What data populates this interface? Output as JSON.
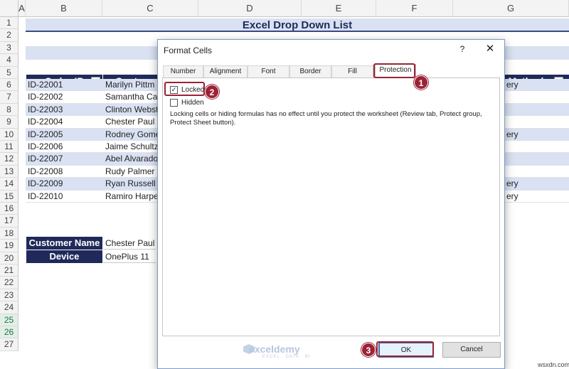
{
  "sheet": {
    "columns": [
      "A",
      "B",
      "C",
      "D",
      "E",
      "F",
      "G"
    ],
    "rows": [
      "1",
      "2",
      "3",
      "4",
      "5",
      "6",
      "7",
      "8",
      "9",
      "10",
      "11",
      "12",
      "13",
      "14",
      "15",
      "16",
      "17",
      "18",
      "19",
      "20",
      "21",
      "22",
      "23",
      "24",
      "25",
      "26",
      "27"
    ],
    "title": "Excel Drop Down List",
    "table_headers": {
      "order_id": "Order ID",
      "customer": "Customer",
      "method": "t Method"
    },
    "order_ids": [
      "ID-22001",
      "ID-22002",
      "ID-22003",
      "ID-22004",
      "ID-22005",
      "ID-22006",
      "ID-22007",
      "ID-22008",
      "ID-22009",
      "ID-22010"
    ],
    "customers": [
      "Marilyn Pittm",
      "Samantha Ca",
      "Clinton Webst",
      "Chester Paul",
      "Rodney Gome",
      "Jaime Schultz",
      "Abel Alvarado",
      "Rudy Palmer",
      "Ryan Russell",
      "Ramiro Harpe"
    ],
    "methods": [
      "ery",
      "",
      "",
      "",
      "ery",
      "",
      "",
      "",
      "ery",
      "ery"
    ],
    "lookup": {
      "customer_label": "Customer Name",
      "customer_value": "Chester Paul",
      "device_label": "Device",
      "device_value": "OnePlus 11"
    }
  },
  "dialog": {
    "title": "Format Cells",
    "help": "?",
    "close": "✕",
    "tabs": [
      "Number",
      "Alignment",
      "Font",
      "Border",
      "Fill",
      "Protection"
    ],
    "locked_label": "Locked",
    "hidden_label": "Hidden",
    "note": "Locking cells or hiding formulas has no effect until you protect the worksheet (Review tab, Protect group, Protect Sheet button).",
    "ok": "OK",
    "cancel": "Cancel"
  },
  "markers": [
    "1",
    "2",
    "3"
  ],
  "watermark": {
    "name": "exceldemy",
    "tagline": "EXCEL · DATA · BI"
  },
  "credit": "wsxdn.com",
  "colors": {
    "header_navy": "#1f2a5a",
    "band_blue": "#d9e1f2",
    "annotation_red": "#9b2335"
  }
}
